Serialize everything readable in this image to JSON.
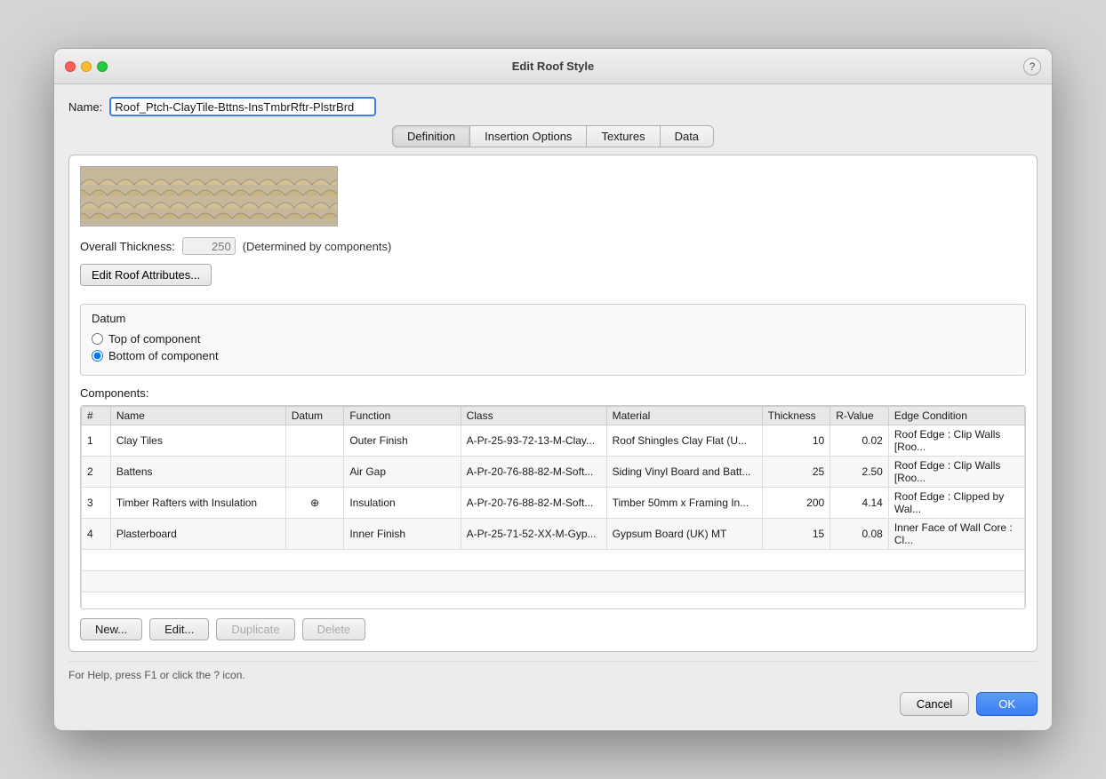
{
  "window": {
    "title": "Edit Roof Style"
  },
  "name_field": {
    "label": "Name:",
    "value": "Roof_Ptch-ClayTile-Bttns-InsTmbrRftr-PlstrBrd"
  },
  "tabs": [
    {
      "id": "definition",
      "label": "Definition",
      "active": true
    },
    {
      "id": "insertion_options",
      "label": "Insertion Options",
      "active": false
    },
    {
      "id": "textures",
      "label": "Textures",
      "active": false
    },
    {
      "id": "data",
      "label": "Data",
      "active": false
    }
  ],
  "overall_thickness": {
    "label": "Overall Thickness:",
    "value": "250",
    "note": "(Determined by components)"
  },
  "edit_attr_btn": "Edit Roof Attributes...",
  "datum": {
    "title": "Datum",
    "options": [
      {
        "id": "top",
        "label": "Top of component",
        "checked": false
      },
      {
        "id": "bottom",
        "label": "Bottom of component",
        "checked": true
      }
    ]
  },
  "components": {
    "title": "Components:",
    "headers": [
      "#",
      "Name",
      "Datum",
      "Function",
      "Class",
      "Material",
      "Thickness",
      "R-Value",
      "Edge Condition"
    ],
    "rows": [
      {
        "num": "1",
        "name": "Clay Tiles",
        "datum": "",
        "function": "Outer Finish",
        "class": "A-Pr-25-93-72-13-M-Clay...",
        "material": "Roof Shingles Clay Flat (U...",
        "thickness": "10",
        "rvalue": "0.02",
        "edge": "Roof Edge : Clip Walls [Roo..."
      },
      {
        "num": "2",
        "name": "Battens",
        "datum": "",
        "function": "Air Gap",
        "class": "A-Pr-20-76-88-82-M-Soft...",
        "material": "Siding Vinyl Board and Batt...",
        "thickness": "25",
        "rvalue": "2.50",
        "edge": "Roof Edge : Clip Walls [Roo..."
      },
      {
        "num": "3",
        "name": "Timber Rafters with Insulation",
        "datum": "⊕",
        "function": "Insulation",
        "class": "A-Pr-20-76-88-82-M-Soft...",
        "material": "Timber 50mm x Framing In...",
        "thickness": "200",
        "rvalue": "4.14",
        "edge": "Roof Edge : Clipped by Wal..."
      },
      {
        "num": "4",
        "name": "Plasterboard",
        "datum": "",
        "function": "Inner Finish",
        "class": "A-Pr-25-71-52-XX-M-Gyp...",
        "material": "Gypsum Board (UK) MT",
        "thickness": "15",
        "rvalue": "0.08",
        "edge": "Inner Face of Wall Core : Cl..."
      }
    ]
  },
  "action_buttons": {
    "new": "New...",
    "edit": "Edit...",
    "duplicate": "Duplicate",
    "delete": "Delete"
  },
  "help_text": "For Help, press F1 or click the ? icon.",
  "bottom_buttons": {
    "cancel": "Cancel",
    "ok": "OK"
  },
  "help_icon": "?"
}
